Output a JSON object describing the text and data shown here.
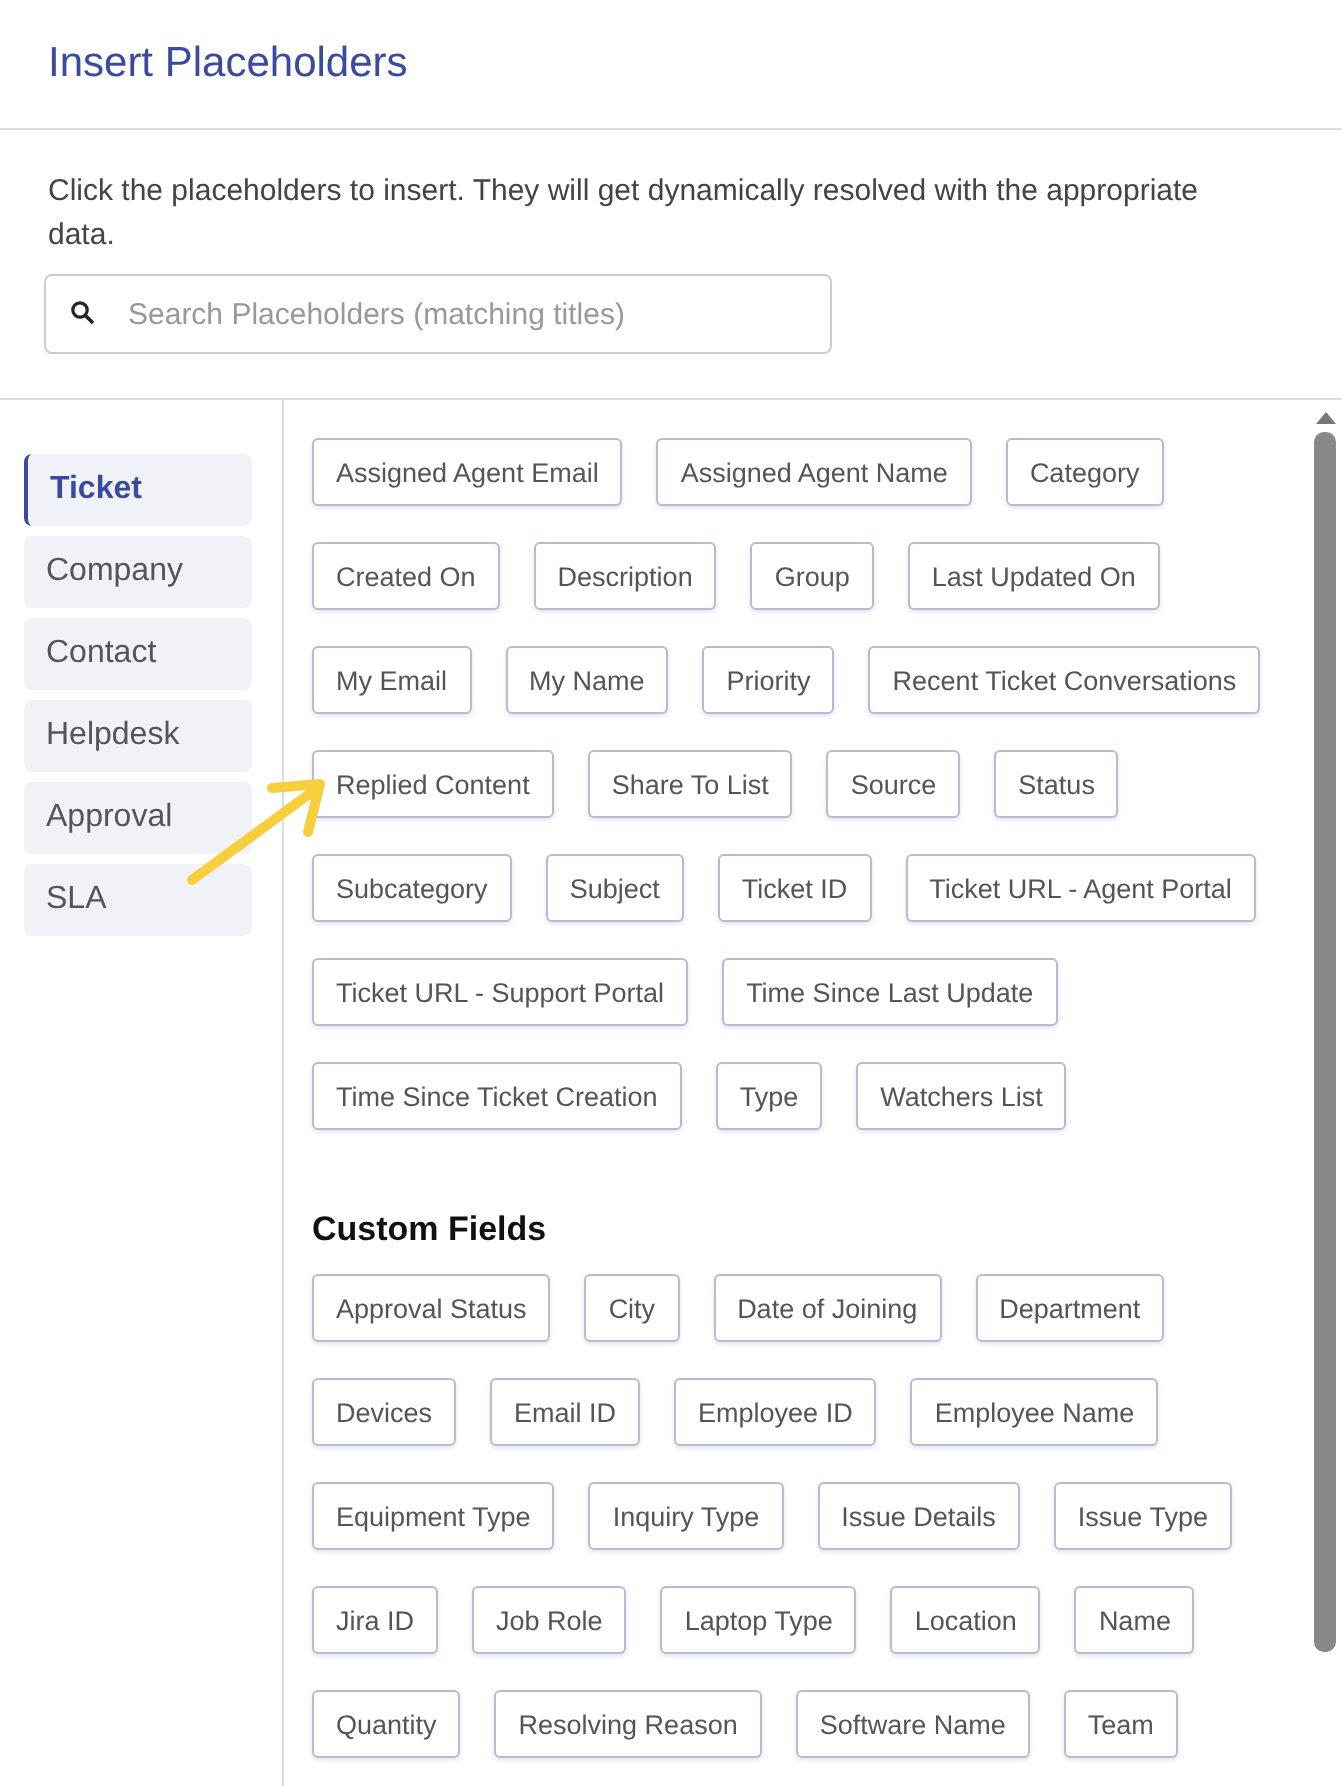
{
  "title": "Insert Placeholders",
  "description": "Click the placeholders to insert. They will get dynamically resolved with the appropriate data.",
  "search": {
    "placeholder": "Search Placeholders (matching titles)"
  },
  "sidebar": {
    "items": [
      {
        "label": "Ticket",
        "selected": true
      },
      {
        "label": "Company",
        "selected": false
      },
      {
        "label": "Contact",
        "selected": false
      },
      {
        "label": "Helpdesk",
        "selected": false
      },
      {
        "label": "Approval",
        "selected": false
      },
      {
        "label": "SLA",
        "selected": false
      }
    ]
  },
  "placeholders": [
    "Assigned Agent Email",
    "Assigned Agent Name",
    "Category",
    "Created On",
    "Description",
    "Group",
    "Last Updated On",
    "My Email",
    "My Name",
    "Priority",
    "Recent Ticket Conversations",
    "Replied Content",
    "Share To List",
    "Source",
    "Status",
    "Subcategory",
    "Subject",
    "Ticket ID",
    "Ticket URL - Agent Portal",
    "Ticket URL - Support Portal",
    "Time Since Last Update",
    "Time Since Ticket Creation",
    "Type",
    "Watchers List"
  ],
  "custom_fields": {
    "heading": "Custom Fields",
    "items": [
      "Approval Status",
      "City",
      "Date of Joining",
      "Department",
      "Devices",
      "Email ID",
      "Employee ID",
      "Employee Name",
      "Equipment Type",
      "Inquiry Type",
      "Issue Details",
      "Issue Type",
      "Jira ID",
      "Job Role",
      "Laptop Type",
      "Location",
      "Name",
      "Quantity",
      "Resolving Reason",
      "Software Name",
      "Team"
    ]
  }
}
